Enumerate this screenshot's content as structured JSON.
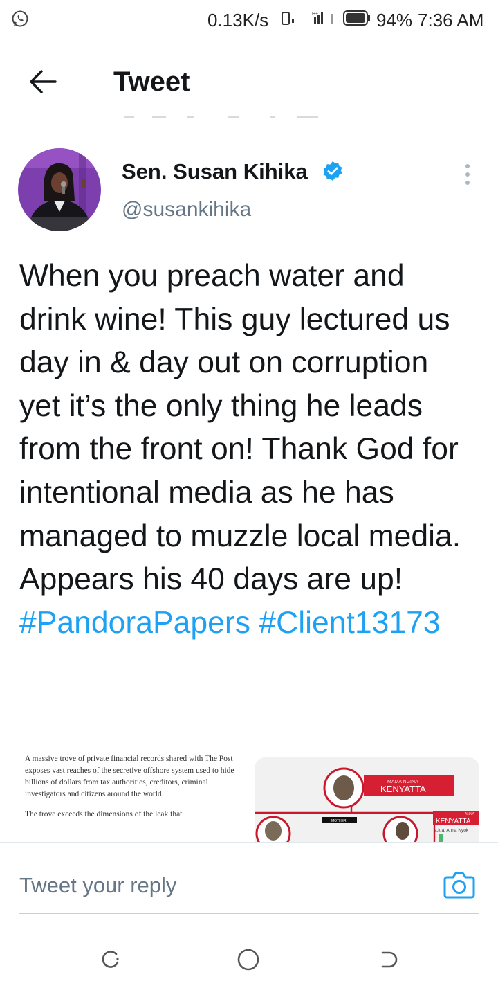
{
  "status_bar": {
    "notification_icon": "whatsapp-icon",
    "network_speed": "0.13K/s",
    "battery_percent": "94%",
    "time": "7:36 AM"
  },
  "app_bar": {
    "title": "Tweet",
    "back_icon": "arrow-left-icon"
  },
  "tweet": {
    "author": {
      "name": "Sen. Susan Kihika",
      "handle": "@susankihika",
      "verified": true
    },
    "text": "When you preach water and drink wine! This guy lectured us day in & day out on corruption yet it’s the only thing he leads from the front on! Thank God for intentional media as he has managed to muzzle local media. Appears his 40 days are up!",
    "hashtags": [
      "#PandoraPapers",
      "#Client13173"
    ],
    "media": [
      {
        "type": "article-excerpt",
        "paragraphs": [
          "A massive trove of private financial records shared with The Post exposes vast reaches of the secretive offshore system used to hide billions of dollars from tax authorities, creditors, criminal investigators and citizens around the world.",
          "The trove exceeds the dimensions of the leak that"
        ]
      },
      {
        "type": "family-diagram",
        "labels": {
          "main_sub": "MAMA NGINA",
          "main": "KENYATTA",
          "relation": "MOTHER",
          "second_sub": "ANNA",
          "second": "KENYATTA",
          "second_alias": "a.k.a. Anna Nyok"
        }
      }
    ]
  },
  "reply": {
    "placeholder": "Tweet your reply",
    "camera_icon": "camera-icon"
  },
  "colors": {
    "accent": "#1da1f2",
    "text": "#14171a",
    "secondary": "#657786",
    "divider": "#e1e8ed"
  }
}
